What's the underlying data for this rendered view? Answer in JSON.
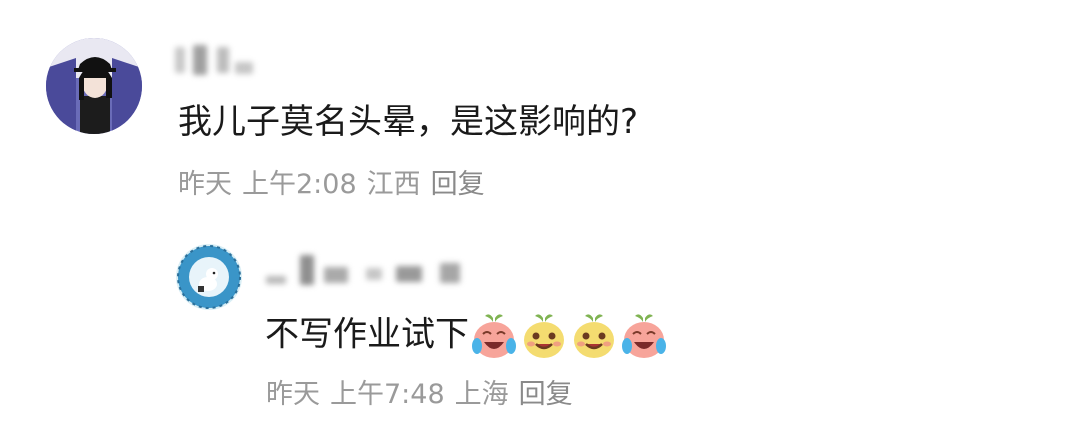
{
  "comment": {
    "text": "我儿子莫名头晕，是这影响的?",
    "date": "昨天",
    "time": "上午2:08",
    "location": "江西",
    "reply_label": "回复"
  },
  "reply": {
    "text": "不写作业试下",
    "emojis": [
      "laugh-cry-face-icon",
      "grin-face-icon",
      "grin-face-icon",
      "laugh-cry-face-icon"
    ],
    "date": "昨天",
    "time": "上午7:48",
    "location": "上海",
    "reply_label": "回复"
  }
}
